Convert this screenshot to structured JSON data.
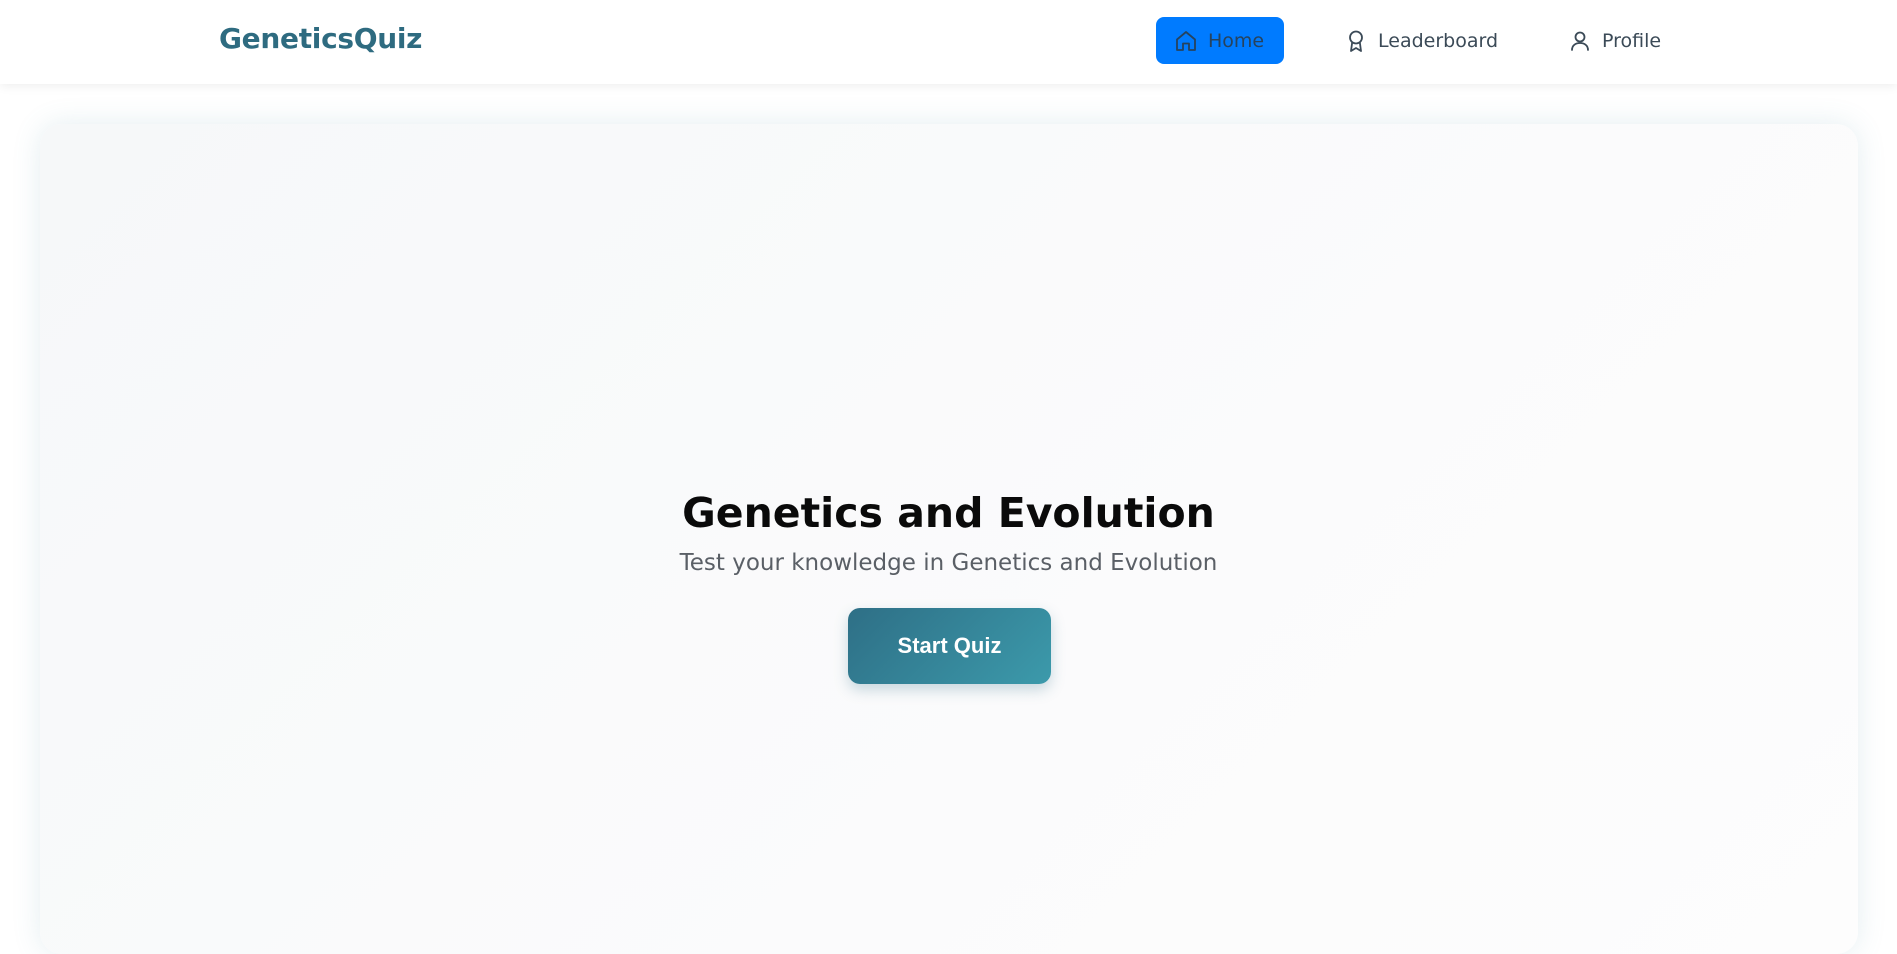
{
  "navbar": {
    "brand": "GeneticsQuiz",
    "items": [
      {
        "label": "Home",
        "icon": "home-icon",
        "active": true
      },
      {
        "label": "Leaderboard",
        "icon": "award-icon",
        "active": false
      },
      {
        "label": "Profile",
        "icon": "user-icon",
        "active": false
      }
    ],
    "active_color": "#007bff"
  },
  "hero": {
    "title": "Genetics and Evolution",
    "subtitle": "Test your knowledge in Genetics and Evolution",
    "button_label": "Start Quiz",
    "button_color": "#2e6f86"
  }
}
